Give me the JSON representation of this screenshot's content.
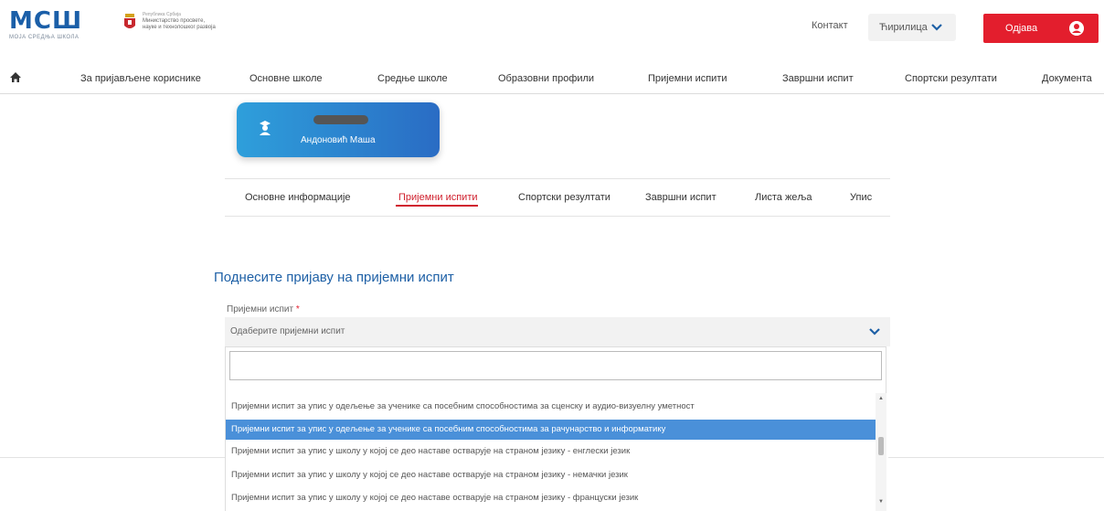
{
  "header": {
    "logo_text": "МСШ",
    "logo_subtitle": "МОЈА СРЕДЊА ШКОЛА",
    "ministry_top": "Република Србија",
    "ministry_line1": "Министарство просвете,",
    "ministry_line2": "науке и технолошког развоја",
    "contact": "Контакт",
    "language": "Ћирилица",
    "logout": "Одјава"
  },
  "nav": {
    "items": [
      "За пријављене кориснике",
      "Основне школе",
      "Средње школе",
      "Образовни профили",
      "Пријемни испити",
      "Завршни испит",
      "Спортски резултати",
      "Документа"
    ]
  },
  "profile": {
    "name": "Андоновић Маша"
  },
  "tabs": {
    "items": [
      "Основне информације",
      "Пријемни испити",
      "Спортски резултати",
      "Завршни испит",
      "Листа жеља",
      "Упис"
    ]
  },
  "form": {
    "title": "Поднесите пријаву на пријемни испит",
    "label": "Пријемни испит",
    "required_mark": "*",
    "placeholder": "Одаберите пријемни испит"
  },
  "dropdown": {
    "options": [
      "Пријемни испит за упис у одељење за ученике са посебним способностима за сценску и аудио-визуелну уметност",
      "Пријемни испит за упис у одељење за ученике са посебним способностима за рачунарство и информатику",
      "Пријемни испит за упис у школу у којој се део наставе остварује на страном језику - енглески језик",
      "Пријемни испит за упис у школу у којој се део наставе остварује на страном језику - немачки језик",
      "Пријемни испит за упис у школу у којој се део наставе остварује на страном језику - француски језик"
    ]
  },
  "colors": {
    "brand_blue": "#1e60a6",
    "brand_red": "#e31e2d",
    "highlight": "#4a90d9"
  }
}
